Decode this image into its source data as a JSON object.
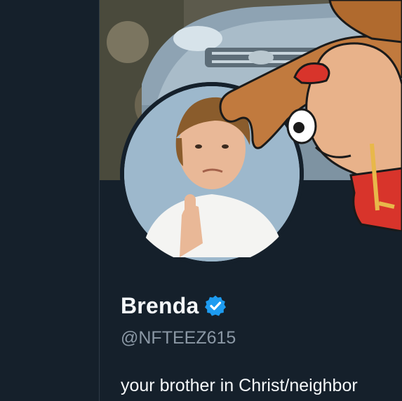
{
  "profile": {
    "display_name": "Brenda",
    "handle": "@NFTEEZ615",
    "bio": "your brother in Christ/neighbor",
    "verified": true
  },
  "icons": {
    "verified": "verified-badge-icon"
  },
  "colors": {
    "background": "#15202b",
    "name_text": "#f5f8fa",
    "handle_text": "#8b98a5",
    "verified_blue": "#1d9bf0"
  }
}
